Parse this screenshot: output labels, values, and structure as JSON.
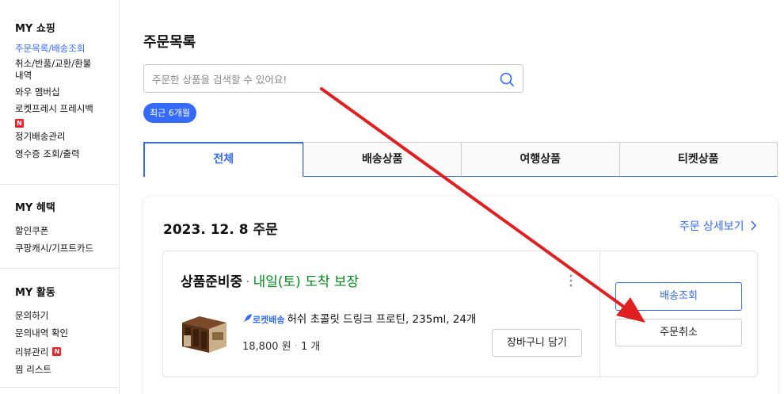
{
  "sidebar": {
    "sections": [
      {
        "title": "MY 쇼핑",
        "items": [
          {
            "label": "주문목록/배송조회"
          },
          {
            "label": "취소/반품/교환/환불"
          },
          {
            "label": "내역"
          },
          {
            "label": "와우 멤버십"
          },
          {
            "label": "로켓프레시 프레시백"
          },
          {
            "label": "정기배송관리"
          },
          {
            "label": "영수증 조회/출력"
          }
        ]
      },
      {
        "title": "MY 혜택",
        "items": [
          {
            "label": "할인쿠폰"
          },
          {
            "label": "쿠팡캐시/기프트카드"
          }
        ]
      },
      {
        "title": "MY 활동",
        "items": [
          {
            "label": "문의하기"
          },
          {
            "label": "문의내역 확인"
          },
          {
            "label": "리뷰관리"
          },
          {
            "label": "찜 리스트"
          }
        ]
      }
    ],
    "new_badge": "N"
  },
  "main": {
    "title": "주문목록",
    "search": {
      "placeholder": "주문한 상품을 검색할 수 있어요!",
      "value": ""
    },
    "period_chip": "최근 6개월",
    "tabs": [
      {
        "label": "전체"
      },
      {
        "label": "배송상품"
      },
      {
        "label": "여행상품"
      },
      {
        "label": "티켓상품"
      }
    ],
    "order": {
      "date": "2023. 12. 8 주문",
      "detail_link": "주문 상세보기",
      "status": "상품준비중",
      "status_separator": "·",
      "arrival": "내일(토) 도착 보장",
      "rocket_label": "로켓배송",
      "product_name": "허쉬 초콜릿 드링크 프로틴, 235ml, 24개",
      "price": "18,800 원",
      "qty": "1 개",
      "price_separator": "·",
      "cart_button": "장바구니 담기",
      "track_button": "배송조회",
      "cancel_button": "주문취소"
    }
  },
  "colors": {
    "accent": "#346aff",
    "arrival_green": "#00891a",
    "annotation_red": "#e02020",
    "badge_red": "#e52528"
  },
  "icons": {
    "search": "search-icon",
    "kebab": "kebab-menu-icon",
    "chevron": "chevron-right-icon",
    "rocket": "rocket-icon"
  }
}
